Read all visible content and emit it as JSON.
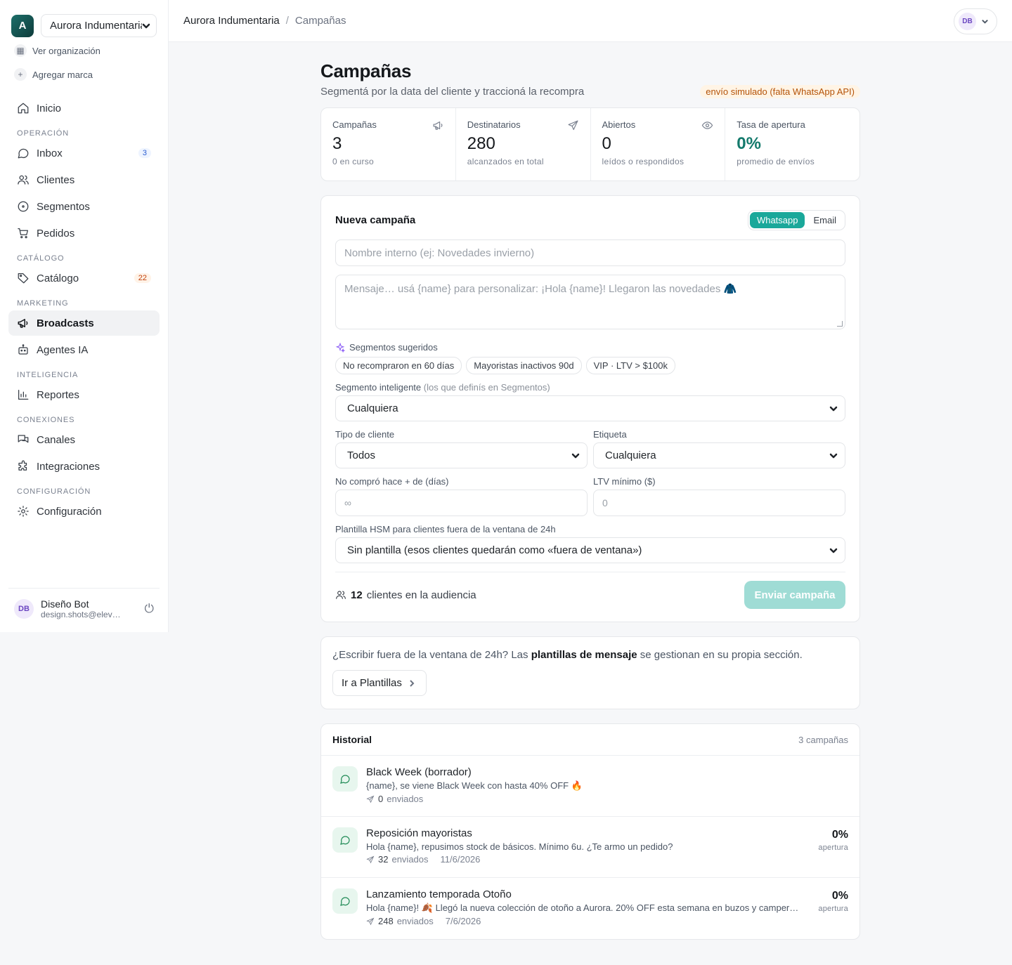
{
  "org": {
    "logo_letter": "A",
    "selected": "Aurora Indumentaria",
    "view_org": "Ver organización",
    "add_brand": "Agregar marca"
  },
  "nav": {
    "home": "Inicio",
    "sections": {
      "operacion": "OPERACIÓN",
      "catalogo": "CATÁLOGO",
      "marketing": "MARKETING",
      "inteligencia": "INTELIGENCIA",
      "conexiones": "CONEXIONES",
      "configuracion": "CONFIGURACIÓN"
    },
    "items": {
      "inbox": "Inbox",
      "inbox_badge": "3",
      "clientes": "Clientes",
      "segmentos": "Segmentos",
      "pedidos": "Pedidos",
      "catalogo": "Catálogo",
      "catalogo_badge": "22",
      "broadcasts": "Broadcasts",
      "agentes": "Agentes IA",
      "reportes": "Reportes",
      "canales": "Canales",
      "integraciones": "Integraciones",
      "configuracion": "Configuración"
    }
  },
  "user": {
    "initials": "DB",
    "name": "Diseño Bot",
    "email": "design.shots@elevate.ai"
  },
  "breadcrumb": {
    "org": "Aurora Indumentaria",
    "separator": "/",
    "current": "Campañas"
  },
  "page": {
    "title": "Campañas",
    "subtitle": "Segmentá por la data del cliente y traccioná la recompra",
    "sim_notice": "envío simulado (falta WhatsApp API)"
  },
  "stats": [
    {
      "label": "Campañas",
      "value": "3",
      "sub": "0 en curso",
      "icon": "megaphone-icon"
    },
    {
      "label": "Destinatarios",
      "value": "280",
      "sub": "alcanzados en total",
      "icon": "send-icon"
    },
    {
      "label": "Abiertos",
      "value": "0",
      "sub": "leídos o respondidos",
      "icon": "eye-icon"
    },
    {
      "label": "Tasa de apertura",
      "value": "0%",
      "sub": "promedio de envíos",
      "accent": "#147a6c"
    }
  ],
  "new_campaign": {
    "title": "Nueva campaña",
    "channels": [
      "Whatsapp",
      "Email"
    ],
    "channel_selected": "Whatsapp",
    "name_placeholder": "Nombre interno (ej: Novedades invierno)",
    "message_placeholder": "Mensaje… usá {name} para personalizar: ¡Hola {name}! Llegaron las novedades 🧥",
    "suggested_title": "Segmentos sugeridos",
    "suggested": [
      "No recompraron en 60 días",
      "Mayoristas inactivos 90d",
      "VIP · LTV > $100k"
    ],
    "smart_segment_label": "Segmento inteligente",
    "smart_segment_hint": "(los que definís en Segmentos)",
    "smart_segment_value": "Cualquiera",
    "client_type_label": "Tipo de cliente",
    "client_type_value": "Todos",
    "tag_label": "Etiqueta",
    "tag_value": "Cualquiera",
    "days_label": "No compró hace + de (días)",
    "days_placeholder": "∞",
    "ltv_label": "LTV mínimo ($)",
    "ltv_placeholder": "0",
    "hsm_label": "Plantilla HSM para clientes fuera de la ventana de 24h",
    "hsm_value": "Sin plantilla (esos clientes quedarán como «fuera de ventana»)",
    "audience_count": "12",
    "audience_text": "clientes en la audiencia",
    "send_label": "Enviar campaña"
  },
  "templates_card": {
    "text_before": "¿Escribir fuera de la ventana de 24h? Las",
    "text_bold": "plantillas de mensaje",
    "text_after": "se gestionan en su propia sección.",
    "button": "Ir a Plantillas"
  },
  "history": {
    "title": "Historial",
    "count": "3 campañas",
    "sent_word": "enviados",
    "rate_word": "apertura",
    "items": [
      {
        "name": "Black Week (borrador)",
        "message": "{name}, se viene Black Week con hasta 40% OFF 🔥",
        "sent": "0",
        "date": "",
        "rate": ""
      },
      {
        "name": "Reposición mayoristas",
        "message": "Hola {name}, repusimos stock de básicos. Mínimo 6u. ¿Te armo un pedido?",
        "sent": "32",
        "date": "11/6/2026",
        "rate": "0%"
      },
      {
        "name": "Lanzamiento temporada Otoño",
        "message": "Hola {name}! 🍂 Llegó la nueva colección de otoño a Aurora. 20% OFF esta semana en buzos y camperas. ¡Te esperamos!",
        "sent": "248",
        "date": "7/6/2026",
        "rate": "0%"
      }
    ]
  }
}
